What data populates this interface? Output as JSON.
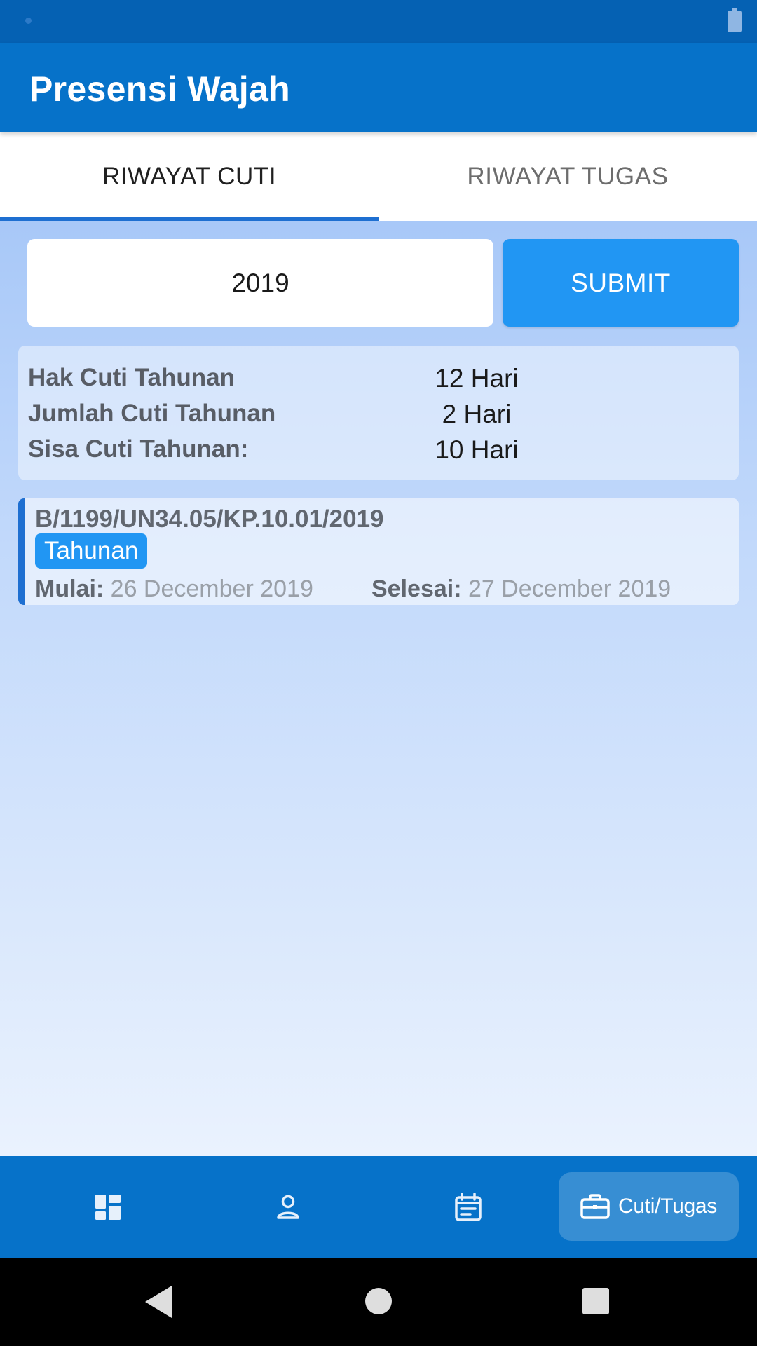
{
  "app": {
    "title": "Presensi Wajah"
  },
  "tabs": [
    {
      "label": "RIWAYAT CUTI",
      "active": true
    },
    {
      "label": "RIWAYAT TUGAS",
      "active": false
    }
  ],
  "filter": {
    "year_value": "2019",
    "submit_label": "SUBMIT"
  },
  "summary": [
    {
      "label": "Hak Cuti Tahunan",
      "value": "12 Hari"
    },
    {
      "label": "Jumlah Cuti Tahunan",
      "value": "2 Hari"
    },
    {
      "label": "Sisa Cuti Tahunan:",
      "value": "10 Hari"
    }
  ],
  "leaves": [
    {
      "number": "B/1199/UN34.05/KP.10.01/2019",
      "type": "Tahunan",
      "start_label": "Mulai:",
      "start_date": "26 December 2019",
      "end_label": "Selesai:",
      "end_date": "27 December 2019"
    }
  ],
  "bottom_nav": {
    "items": [
      {
        "icon": "dashboard-icon"
      },
      {
        "icon": "person-icon"
      },
      {
        "icon": "calendar-icon"
      },
      {
        "icon": "briefcase-icon",
        "label": "Cuti/Tugas",
        "active": true
      }
    ]
  },
  "colors": {
    "primary": "#0672c9",
    "accent": "#2196f3",
    "tab_indicator": "#1e6fd1"
  }
}
